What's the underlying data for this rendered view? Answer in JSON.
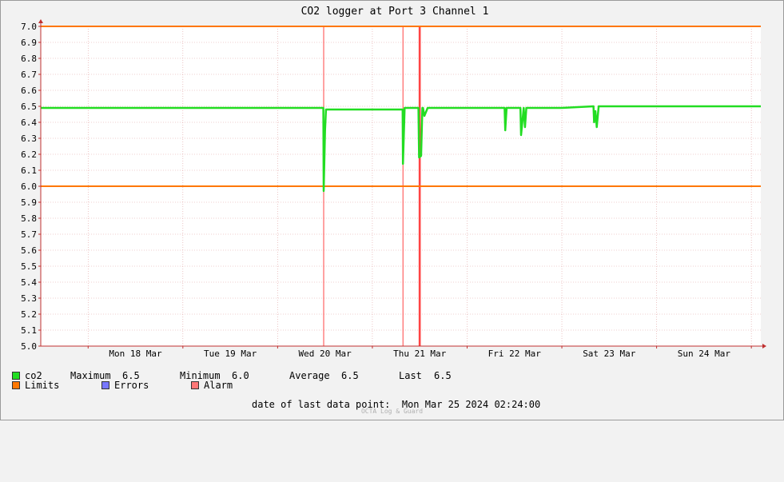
{
  "chart_data": {
    "type": "line",
    "title": "CO2 logger at Port 3 Channel 1",
    "ylim": [
      5.0,
      7.0
    ],
    "xlim": [
      "2024-03-17T12:00",
      "2024-03-25T02:24"
    ],
    "y_ticks": [
      "5.0",
      "5.1",
      "5.2",
      "5.3",
      "5.4",
      "5.5",
      "5.6",
      "5.7",
      "5.8",
      "5.9",
      "6.0",
      "6.1",
      "6.2",
      "6.3",
      "6.4",
      "6.5",
      "6.6",
      "6.7",
      "6.8",
      "6.9",
      "7.0"
    ],
    "x_ticks": [
      {
        "label": "Mon 18 Mar",
        "at": "2024-03-18T12:00"
      },
      {
        "label": "Tue 19 Mar",
        "at": "2024-03-19T12:00"
      },
      {
        "label": "Wed 20 Mar",
        "at": "2024-03-20T12:00"
      },
      {
        "label": "Thu 21 Mar",
        "at": "2024-03-21T12:00"
      },
      {
        "label": "Fri 22 Mar",
        "at": "2024-03-22T12:00"
      },
      {
        "label": "Sat 23 Mar",
        "at": "2024-03-23T12:00"
      },
      {
        "label": "Sun 24 Mar",
        "at": "2024-03-24T12:00"
      }
    ],
    "x_grid_at": [
      "2024-03-18T00:00",
      "2024-03-19T00:00",
      "2024-03-20T00:00",
      "2024-03-21T00:00",
      "2024-03-22T00:00",
      "2024-03-23T00:00",
      "2024-03-24T00:00",
      "2024-03-25T00:00"
    ],
    "grid": true,
    "series": [
      {
        "name": "co2",
        "color": "#22dd22",
        "points": [
          [
            "2024-03-17T12:00",
            6.49
          ],
          [
            "2024-03-18T00:00",
            6.49
          ],
          [
            "2024-03-18T12:00",
            6.49
          ],
          [
            "2024-03-19T00:00",
            6.49
          ],
          [
            "2024-03-19T12:00",
            6.49
          ],
          [
            "2024-03-20T00:00",
            6.49
          ],
          [
            "2024-03-20T11:30",
            6.49
          ],
          [
            "2024-03-20T11:35",
            6.49
          ],
          [
            "2024-03-20T11:40",
            5.97
          ],
          [
            "2024-03-20T12:00",
            6.35
          ],
          [
            "2024-03-20T12:15",
            6.48
          ],
          [
            "2024-03-21T00:00",
            6.48
          ],
          [
            "2024-03-21T07:40",
            6.48
          ],
          [
            "2024-03-21T07:45",
            6.14
          ],
          [
            "2024-03-21T08:10",
            6.49
          ],
          [
            "2024-03-21T11:40",
            6.49
          ],
          [
            "2024-03-21T11:50",
            6.18
          ],
          [
            "2024-03-21T12:20",
            6.19
          ],
          [
            "2024-03-21T12:40",
            6.49
          ],
          [
            "2024-03-21T12:50",
            6.49
          ],
          [
            "2024-03-21T13:10",
            6.44
          ],
          [
            "2024-03-21T14:00",
            6.49
          ],
          [
            "2024-03-22T00:00",
            6.49
          ],
          [
            "2024-03-22T09:30",
            6.49
          ],
          [
            "2024-03-22T09:40",
            6.35
          ],
          [
            "2024-03-22T10:00",
            6.49
          ],
          [
            "2024-03-22T13:30",
            6.49
          ],
          [
            "2024-03-22T13:40",
            6.32
          ],
          [
            "2024-03-22T14:20",
            6.49
          ],
          [
            "2024-03-22T14:40",
            6.37
          ],
          [
            "2024-03-22T15:00",
            6.49
          ],
          [
            "2024-03-23T00:00",
            6.49
          ],
          [
            "2024-03-23T08:00",
            6.5
          ],
          [
            "2024-03-23T08:10",
            6.4
          ],
          [
            "2024-03-23T08:30",
            6.47
          ],
          [
            "2024-03-23T08:50",
            6.37
          ],
          [
            "2024-03-23T09:20",
            6.5
          ],
          [
            "2024-03-24T00:00",
            6.5
          ],
          [
            "2024-03-24T12:00",
            6.5
          ],
          [
            "2024-03-25T00:00",
            6.5
          ],
          [
            "2024-03-25T02:24",
            6.5
          ]
        ]
      },
      {
        "name": "limit-high",
        "color": "#ff7700",
        "points": [
          [
            "2024-03-17T12:00",
            7.0
          ],
          [
            "2024-03-25T02:24",
            7.0
          ]
        ]
      },
      {
        "name": "limit-low",
        "color": "#ff7700",
        "points": [
          [
            "2024-03-17T12:00",
            6.0
          ],
          [
            "2024-03-25T02:24",
            6.0
          ]
        ]
      }
    ],
    "alarm_lines": [
      "2024-03-20T11:40",
      "2024-03-21T07:45",
      "2024-03-21T11:50",
      "2024-03-21T12:00"
    ]
  },
  "legend": {
    "co2": {
      "label": "co2",
      "color": "#22dd22",
      "stats": [
        {
          "label": "Maximum",
          "value": "6.5"
        },
        {
          "label": "Minimum",
          "value": "6.0"
        },
        {
          "label": "Average",
          "value": "6.5"
        },
        {
          "label": "Last",
          "value": "6.5"
        }
      ]
    },
    "limits": {
      "label": "Limits",
      "color": "#ff7700"
    },
    "errors": {
      "label": "Errors",
      "color": "#7777ff"
    },
    "alarm": {
      "label": "Alarm",
      "color": "#ff7777"
    }
  },
  "footer": {
    "date_label": "date of last data point:",
    "date_value": "Mon Mar 25 2024 02:24:00",
    "brand": "OCTA Log & Guard"
  }
}
